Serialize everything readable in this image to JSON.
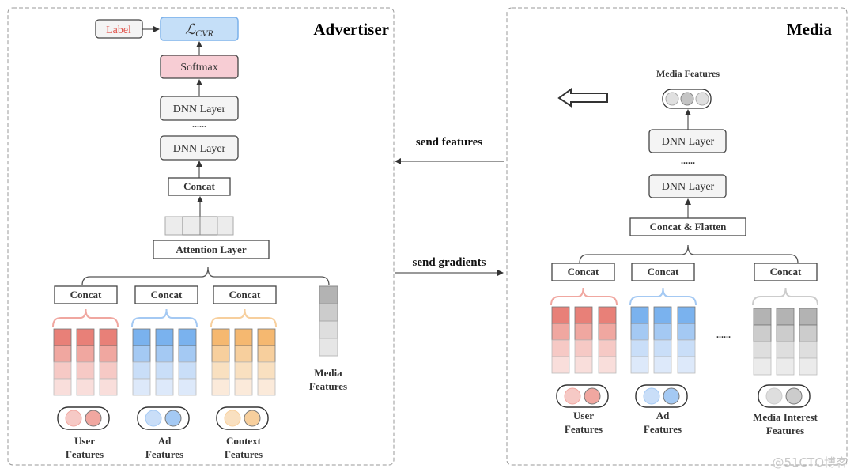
{
  "advertiser": {
    "title": "Advertiser",
    "label": "Label",
    "loss": "ℒ",
    "loss_sub": "CVR",
    "softmax": "Softmax",
    "dnn1": "DNN Layer",
    "dots": "......",
    "dnn2": "DNN Layer",
    "concat_top": "Concat",
    "attention": "Attention Layer",
    "groups": [
      {
        "concat": "Concat",
        "label1": "User",
        "label2": "Features",
        "color": "red"
      },
      {
        "concat": "Concat",
        "label1": "Ad",
        "label2": "Features",
        "color": "blue"
      },
      {
        "concat": "Concat",
        "label1": "Context",
        "label2": "Features",
        "color": "orange"
      }
    ],
    "media_label1": "Media",
    "media_label2": "Features"
  },
  "channel": {
    "send_features": "send features",
    "send_gradients": "send gradients"
  },
  "media": {
    "title": "Media",
    "media_features": "Media Features",
    "dnn1": "DNN Layer",
    "dots": "......",
    "dnn2": "DNN Layer",
    "concat_flatten": "Concat & Flatten",
    "groups": [
      {
        "concat": "Concat",
        "label1": "User",
        "label2": "Features",
        "color": "red"
      },
      {
        "concat": "Concat",
        "label1": "Ad",
        "label2": "Features",
        "color": "blue"
      },
      {
        "concat": "Concat",
        "label1": "Media Interest",
        "label2": "Features",
        "color": "gray"
      }
    ],
    "between_dots": "......"
  },
  "watermark": "@51CTO博客",
  "colors": {
    "red": [
      "#e88078",
      "#f0a7a0",
      "#f6c9c5",
      "#f9dedb"
    ],
    "blue": [
      "#7ab2ee",
      "#a4c9f3",
      "#c9def8",
      "#dde9fa"
    ],
    "orange": [
      "#f5b870",
      "#f7cf9d",
      "#f9e0c0",
      "#fbeada"
    ],
    "gray": [
      "#b3b3b3",
      "#cccccc",
      "#dedede",
      "#ebebeb"
    ],
    "loss_fill": "#c5dff8",
    "loss_stroke": "#7ab0ea",
    "softmax_fill": "#f7cdd4",
    "label_text": "#e0524a"
  }
}
